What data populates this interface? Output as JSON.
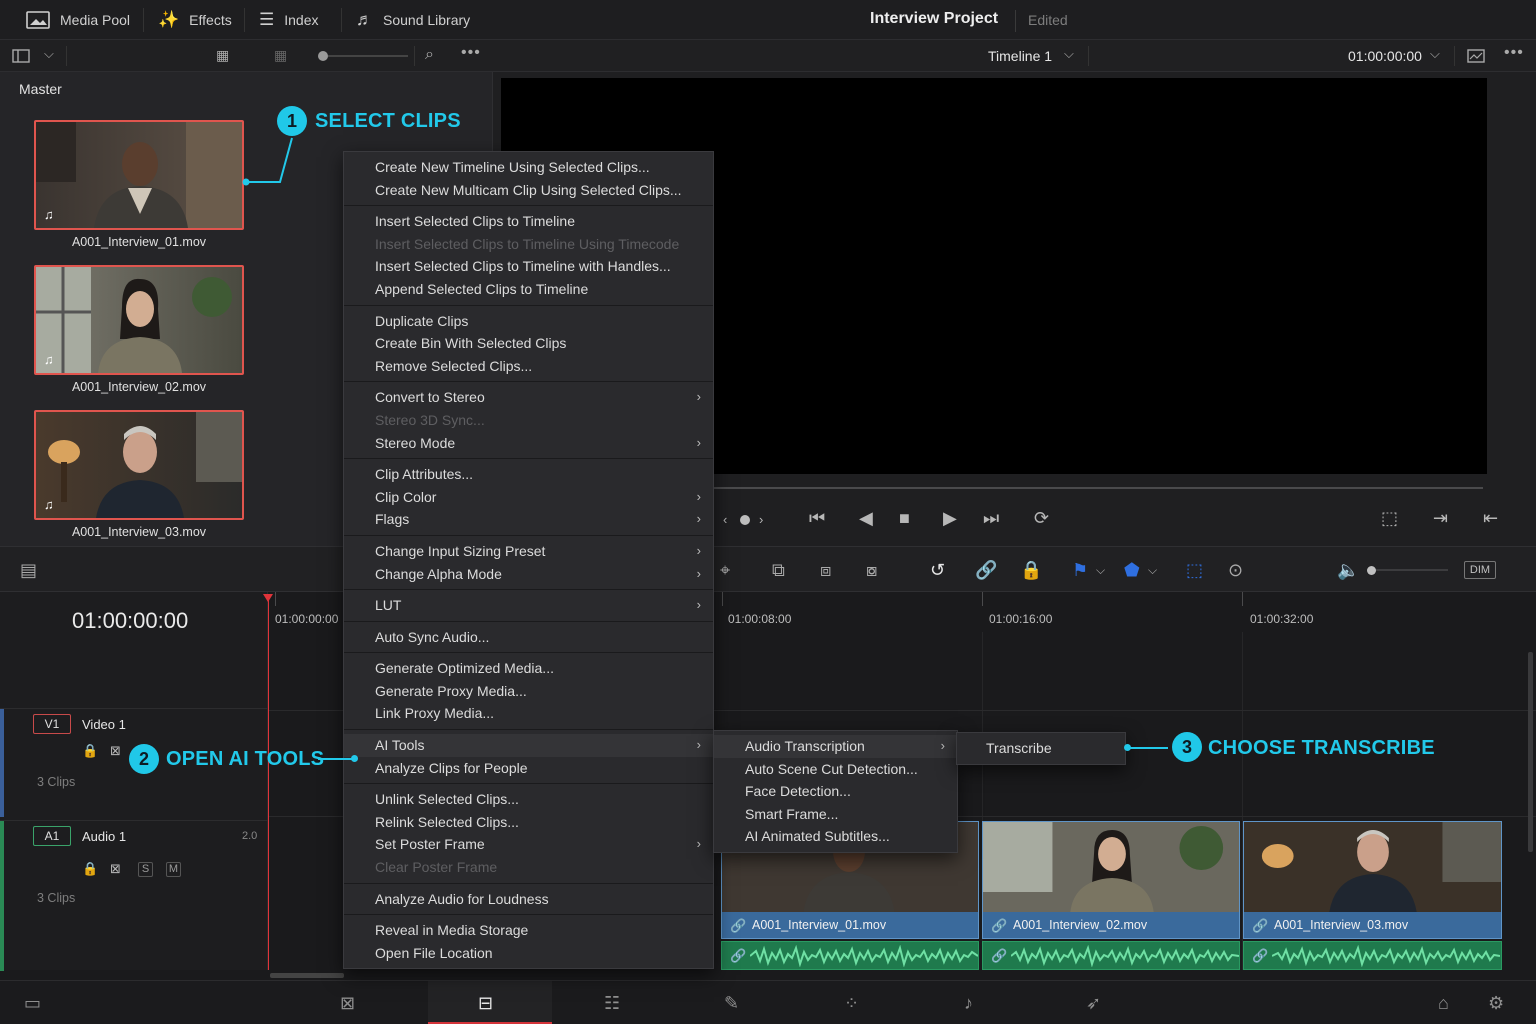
{
  "topbar": {
    "media_pool": "Media Pool",
    "effects": "Effects",
    "index": "Index",
    "sound_library": "Sound Library",
    "project_title": "Interview Project",
    "project_status": "Edited"
  },
  "toolbar2": {
    "timeline_name": "Timeline 1",
    "timecode": "01:00:00:00"
  },
  "media_pool": {
    "bin": "Master",
    "clips": [
      {
        "name": "A001_Interview_01.mov"
      },
      {
        "name": "A001_Interview_02.mov"
      },
      {
        "name": "A001_Interview_03.mov"
      }
    ]
  },
  "timeline": {
    "timecode": "01:00:00:00",
    "ruler": [
      "01:00:00:00",
      "01:00:08:00",
      "01:00:16:00",
      "01:00:32:00"
    ],
    "tracks": [
      {
        "id": "V1",
        "name": "Video 1",
        "clips": "3 Clips"
      },
      {
        "id": "A1",
        "name": "Audio 1",
        "clips": "3 Clips",
        "channel": "2.0",
        "solo": "S",
        "mute": "M"
      }
    ],
    "video_clips": [
      "A001_Interview_01.mov",
      "A001_Interview_02.mov",
      "A001_Interview_03.mov"
    ],
    "dim_label": "DIM"
  },
  "context_menu": {
    "groups": [
      [
        {
          "label": "Create New Timeline Using Selected Clips..."
        },
        {
          "label": "Create New Multicam Clip Using Selected Clips..."
        }
      ],
      [
        {
          "label": "Insert Selected Clips to Timeline"
        },
        {
          "label": "Insert Selected Clips to Timeline Using Timecode",
          "disabled": true
        },
        {
          "label": "Insert Selected Clips to Timeline with Handles..."
        },
        {
          "label": "Append Selected Clips to Timeline"
        }
      ],
      [
        {
          "label": "Duplicate Clips"
        },
        {
          "label": "Create Bin With Selected Clips"
        },
        {
          "label": "Remove Selected Clips..."
        }
      ],
      [
        {
          "label": "Convert to Stereo",
          "submenu": true
        },
        {
          "label": "Stereo 3D Sync...",
          "disabled": true
        },
        {
          "label": "Stereo Mode",
          "submenu": true
        }
      ],
      [
        {
          "label": "Clip Attributes..."
        },
        {
          "label": "Clip Color",
          "submenu": true
        },
        {
          "label": "Flags",
          "submenu": true
        }
      ],
      [
        {
          "label": "Change Input Sizing Preset",
          "submenu": true
        },
        {
          "label": "Change Alpha Mode",
          "submenu": true
        }
      ],
      [
        {
          "label": "LUT",
          "submenu": true
        }
      ],
      [
        {
          "label": "Auto Sync Audio..."
        }
      ],
      [
        {
          "label": "Generate Optimized Media..."
        },
        {
          "label": "Generate Proxy Media..."
        },
        {
          "label": "Link Proxy Media..."
        }
      ],
      [
        {
          "label": "AI Tools",
          "submenu": true,
          "highlighted": true
        },
        {
          "label": "Analyze Clips for People"
        }
      ],
      [
        {
          "label": "Unlink Selected Clips..."
        },
        {
          "label": "Relink Selected Clips..."
        },
        {
          "label": "Set Poster Frame",
          "submenu": true
        },
        {
          "label": "Clear Poster Frame",
          "disabled": true
        }
      ],
      [
        {
          "label": "Analyze Audio for Loudness"
        }
      ],
      [
        {
          "label": "Reveal in Media Storage"
        },
        {
          "label": "Open File Location"
        }
      ]
    ]
  },
  "ai_submenu": [
    {
      "label": "Audio Transcription",
      "submenu": true,
      "highlighted": true
    },
    {
      "label": "Auto Scene Cut Detection..."
    },
    {
      "label": "Face Detection..."
    },
    {
      "label": "Smart Frame..."
    },
    {
      "label": "AI Animated Subtitles..."
    }
  ],
  "transcription_submenu": [
    {
      "label": "Transcribe"
    }
  ],
  "callouts": [
    {
      "num": "1",
      "text": "SELECT CLIPS"
    },
    {
      "num": "2",
      "text": "OPEN AI TOOLS"
    },
    {
      "num": "3",
      "text": "CHOOSE TRANSCRIBE"
    }
  ],
  "colors": {
    "accent": "#22c9ea",
    "selection": "#e0554e",
    "playhead": "#e0343a",
    "video_clip": "#3a6a9c",
    "audio_clip": "#1f7a4d"
  }
}
